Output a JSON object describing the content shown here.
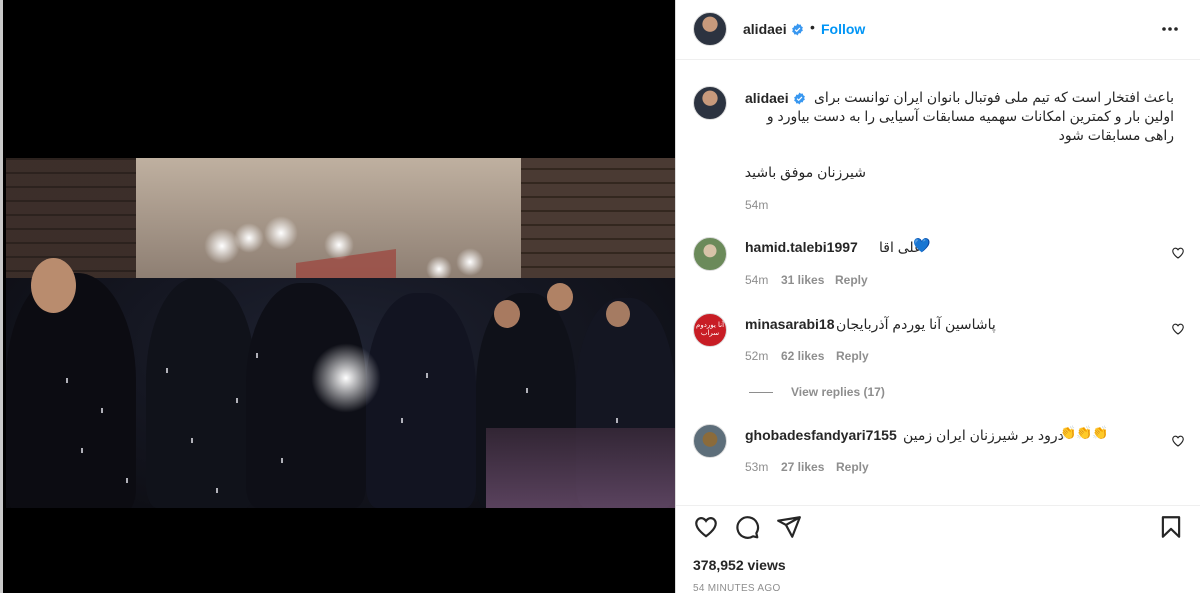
{
  "post": {
    "username": "alidaei",
    "follow_label": "Follow",
    "separator": "•",
    "caption_line1": "باعث افتخار است که تیم ملی فوتبال بانوان ایران توانست برای",
    "caption_line2": "اولین بار و کمترین امکانات سهمیه مسابقات آسیایی را به دست بیاورد و",
    "caption_line3": "راهی مسابقات شود",
    "caption_line4": "شیرزنان موفق باشید",
    "caption_time": "54m",
    "views": "378,952 views",
    "posted_ago": "54 MINUTES AGO"
  },
  "comments": [
    {
      "username": "hamid.talebi1997",
      "text": "علی اقا",
      "emoji": "💙",
      "time": "54m",
      "likes": "31 likes",
      "reply": "Reply",
      "avatar": "outdoor"
    },
    {
      "username": "minasarabi18",
      "text": "پاشاسین آنا یوردم آذربایجان",
      "time": "52m",
      "likes": "62 likes",
      "reply": "Reply",
      "avatar_text": "آنا یوردوم سراب",
      "view_replies": "View replies (17)"
    },
    {
      "username": "ghobadesfandyari7155",
      "text": "درود بر شیرزنان ایران زمین",
      "emoji": "👏👏👏",
      "time": "53m",
      "likes": "27 likes",
      "reply": "Reply",
      "avatar": "desert"
    }
  ],
  "icons": {
    "more": "more-icon",
    "like": "heart-icon",
    "comment": "comment-icon",
    "share": "share-icon",
    "save": "bookmark-icon",
    "verified": "verified-badge-icon"
  },
  "colors": {
    "accent": "#0095f6",
    "text": "#262626",
    "muted": "#8e8e8e",
    "verified": "#3897f0",
    "heart_emoji": "#1f6fd1"
  }
}
